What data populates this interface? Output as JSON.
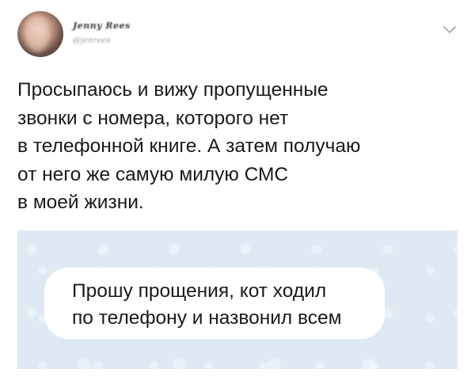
{
  "post": {
    "author_name": "Jenny Rees",
    "author_handle": "@jenrees",
    "text": "Просыпаюсь и вижу пропущенные\nзвонки с номера, которого нет\nв телефонной книге. А затем получаю\nот него же самую милую СМС\nв моей жизни."
  },
  "message": {
    "text": "Прошу прощения, кот ходил\nпо телефону и назвонил всем",
    "bubble_color": "#ffffff",
    "background_color": "#dfe9f4"
  },
  "icons": {
    "menu": "chevron-down-icon",
    "avatar": "avatar"
  }
}
